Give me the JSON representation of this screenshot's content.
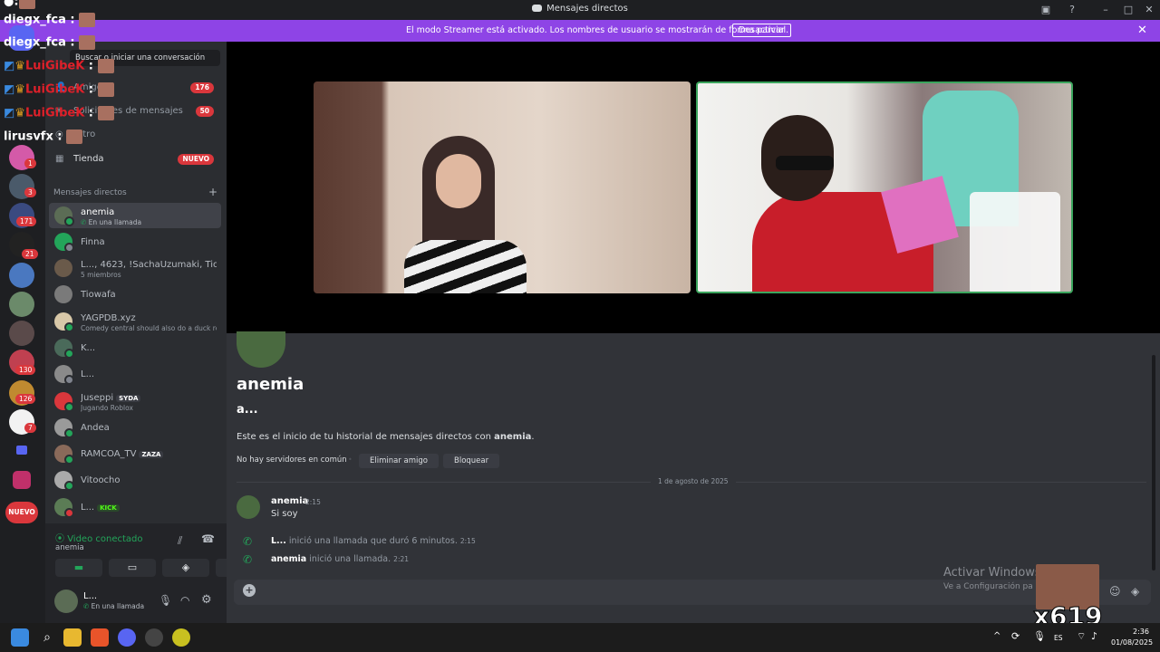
{
  "window": {
    "title": "Mensajes directos"
  },
  "banner": {
    "message": "El modo Streamer está activado. Los nombres de usuario se mostrarán de forma parcial.",
    "button": "Desactivar"
  },
  "rail_badges": [
    "1",
    "3",
    "171",
    "21",
    "130",
    "126",
    "7"
  ],
  "rail_new": "NUEVO",
  "sidebar": {
    "search_placeholder": "Buscar o iniciar una conversación",
    "nav": [
      {
        "label": "Amigos",
        "count": "176"
      },
      {
        "label": "Solicitudes de mensajes",
        "count": "50"
      },
      {
        "label": "Nitro",
        "count": ""
      },
      {
        "label": "Tienda",
        "count": "NUEVO"
      }
    ],
    "dm_header": "Mensajes directos",
    "dms": [
      {
        "name": "anemia",
        "sub": "En una llamada",
        "tag": ""
      },
      {
        "name": "Finna",
        "sub": "",
        "tag": ""
      },
      {
        "name": "L..., 4623, !SachaUzumaki, Tio...",
        "sub": "5 miembros",
        "tag": ""
      },
      {
        "name": "Tiowafa",
        "sub": "",
        "tag": ""
      },
      {
        "name": "YAGPDB.xyz",
        "sub": "Comedy central should also do a duck ro...",
        "tag": ""
      },
      {
        "name": "K...",
        "sub": "",
        "tag": ""
      },
      {
        "name": "L...",
        "sub": "",
        "tag": ""
      },
      {
        "name": "Juseppi",
        "sub": "Jugando Roblox",
        "tag": "SYDA"
      },
      {
        "name": "Andea",
        "sub": "",
        "tag": ""
      },
      {
        "name": "RAMCOA_TV",
        "sub": "",
        "tag": "ZAZA"
      },
      {
        "name": "Vitoocho",
        "sub": "",
        "tag": ""
      },
      {
        "name": "L...",
        "sub": "",
        "tag": "KICK"
      }
    ]
  },
  "voice": {
    "status": "Video conectado",
    "channel": "anemia"
  },
  "user": {
    "name": "L...",
    "status": "En una llamada"
  },
  "chat": {
    "profile_name": "anemia",
    "profile_sub": "a...",
    "intro_prefix": "Este es el inicio de tu historial de mensajes directos con ",
    "intro_name": "anemia",
    "no_servers": "No hay servidores en común",
    "remove_friend": "Eliminar amigo",
    "block": "Bloquear",
    "date_divider": "1 de agosto de 2025",
    "message_author": "anemia",
    "message_time": "2:15",
    "message_text": "Si soy",
    "call1_user": "L...",
    "call1_text": " inició una llamada que duró 6 minutos.",
    "call1_time": "2:15",
    "call2_user": "anemia",
    "call2_text": " inició una llamada.",
    "call2_time": "2:21"
  },
  "watermark": {
    "line1": "Activar Windows",
    "line2": "Ve a Configuración pa"
  },
  "overlay": {
    "lines": [
      {
        "user": "diegx_fca",
        "sep": " :"
      },
      {
        "user": "diegx_fca",
        "sep": " :"
      },
      {
        "user": "LuiGibeK",
        "sep": " :"
      },
      {
        "user": "LuiGibeK",
        "sep": " :"
      },
      {
        "user": "LuiGibeK",
        "sep": " :"
      },
      {
        "user": "lirusvfx",
        "sep": " :"
      }
    ],
    "counter": "x619"
  },
  "taskbar": {
    "lang": "ES",
    "time": "2:36",
    "date": "01/08/2025"
  }
}
